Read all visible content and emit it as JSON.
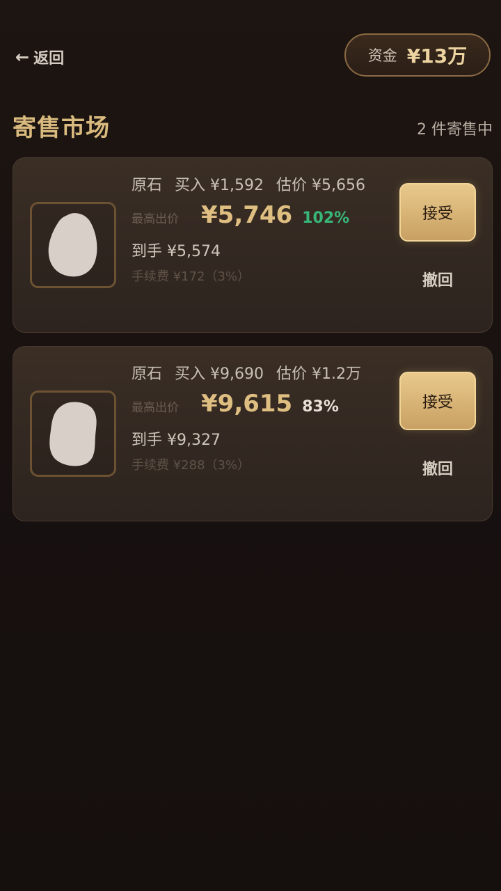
{
  "nav": {
    "back_arrow": "←",
    "back_label": "返回",
    "funds_label": "资金",
    "funds_value": "¥13万"
  },
  "page": {
    "title": "寄售市场",
    "count_label": "2 件寄售中"
  },
  "listings": [
    {
      "name": "原石",
      "buy": "买入 ¥1,592",
      "estimate": "估价 ¥5,656",
      "bid_label": "最高出价",
      "bid_value": "¥5,746",
      "percent": "102%",
      "received": "到手 ¥5,574",
      "fee": "手续费 ¥172（3%）",
      "accept_label": "接受",
      "withdraw_label": "撤回"
    },
    {
      "name": "原石",
      "buy": "买入 ¥9,690",
      "estimate": "估价 ¥1.2万",
      "bid_label": "最高出价",
      "bid_value": "¥9,615",
      "percent": "83%",
      "received": "到手 ¥9,327",
      "fee": "手续费 ¥288（3%）",
      "accept_label": "接受",
      "withdraw_label": "撤回"
    }
  ],
  "colors": {
    "gold_text": "#dfbf81",
    "title_gold": "#d9ba7e",
    "positive_percent": "#37b878",
    "neutral_percent": "#eae1d8",
    "background": "#181110"
  },
  "icons": {
    "back": "arrow-left-icon",
    "stone": "stone-icon"
  }
}
